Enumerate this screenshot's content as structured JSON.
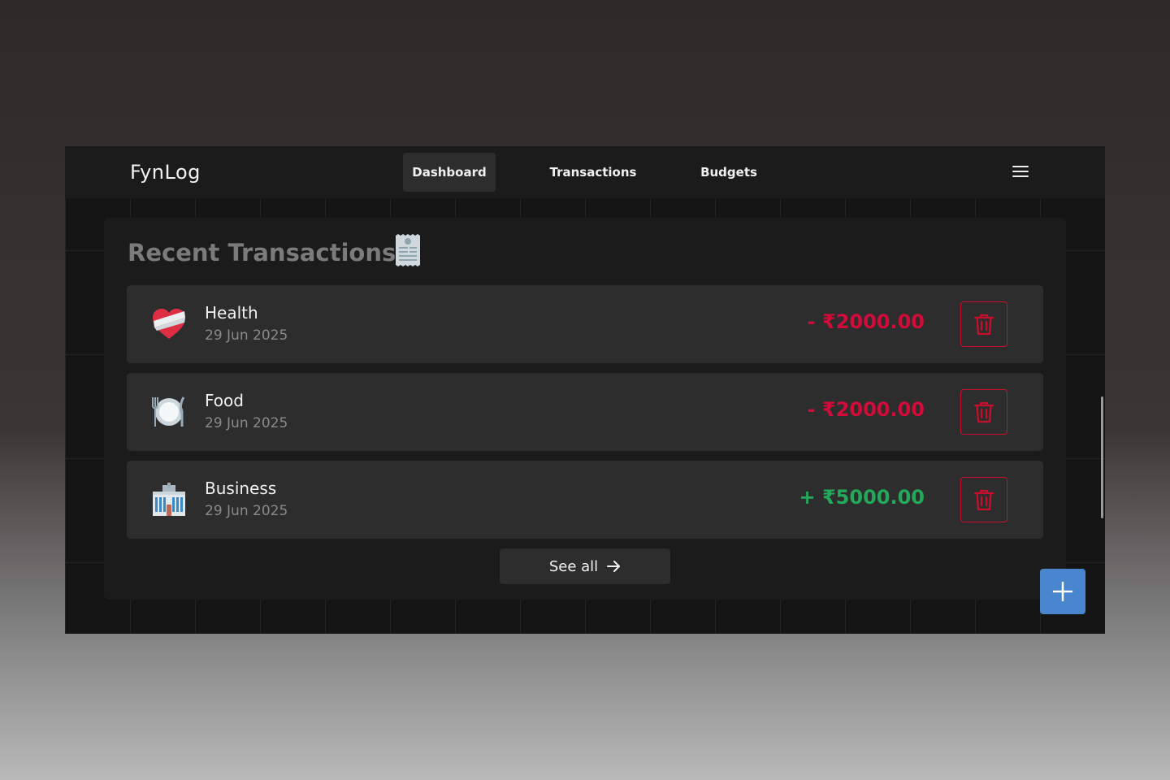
{
  "nav": {
    "brand": "FynLog",
    "items": [
      "Dashboard",
      "Transactions",
      "Budgets"
    ],
    "active": "Dashboard",
    "menu_icon": "hamburger-menu-icon"
  },
  "recent": {
    "title": "Recent Transactions",
    "title_icon": "receipt-icon",
    "transactions": [
      {
        "category": "Health",
        "date": "29 Jun 2025",
        "amount": "- ₹2000.00",
        "type": "debit",
        "icon": "mending-heart-icon"
      },
      {
        "category": "Food",
        "date": "29 Jun 2025",
        "amount": "- ₹2000.00",
        "type": "debit",
        "icon": "fork-knife-plate-icon"
      },
      {
        "category": "Business",
        "date": "29 Jun 2025",
        "amount": "+ ₹5000.00",
        "type": "credit",
        "icon": "office-building-icon"
      }
    ],
    "see_all_label": "See all"
  },
  "fab_icon": "plus-icon",
  "colors": {
    "debit": "#d10b3a",
    "credit": "#24a85a",
    "delete_border": "#c8102e",
    "fab": "#4a86cf"
  }
}
